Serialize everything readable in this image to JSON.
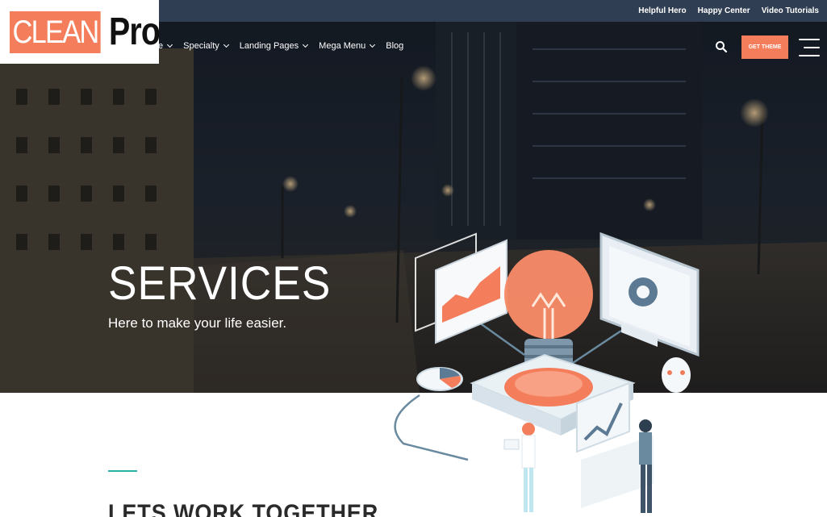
{
  "brand": {
    "logo_part1": "CLEAN",
    "logo_part2": "Pro",
    "accent": "#f47d5b",
    "topbar_bg": "#2f3e52"
  },
  "topbar": {
    "links": [
      "Helpful Hero",
      "Happy Center",
      "Video Tutorials"
    ]
  },
  "nav": {
    "items": [
      {
        "label": "e",
        "has_dropdown": true
      },
      {
        "label": "Specialty",
        "has_dropdown": true
      },
      {
        "label": "Landing Pages",
        "has_dropdown": true
      },
      {
        "label": "Mega Menu",
        "has_dropdown": true
      },
      {
        "label": "Blog",
        "has_dropdown": false
      }
    ],
    "search_icon": "search-icon",
    "cta_label": "GET THEME",
    "menu_icon": "hamburger-icon"
  },
  "hero": {
    "title": "SERVICES",
    "subtitle": "Here to make your life easier."
  },
  "section": {
    "heading": "LETS WORK TOGETHER",
    "accent_color": "#27b3a9"
  }
}
